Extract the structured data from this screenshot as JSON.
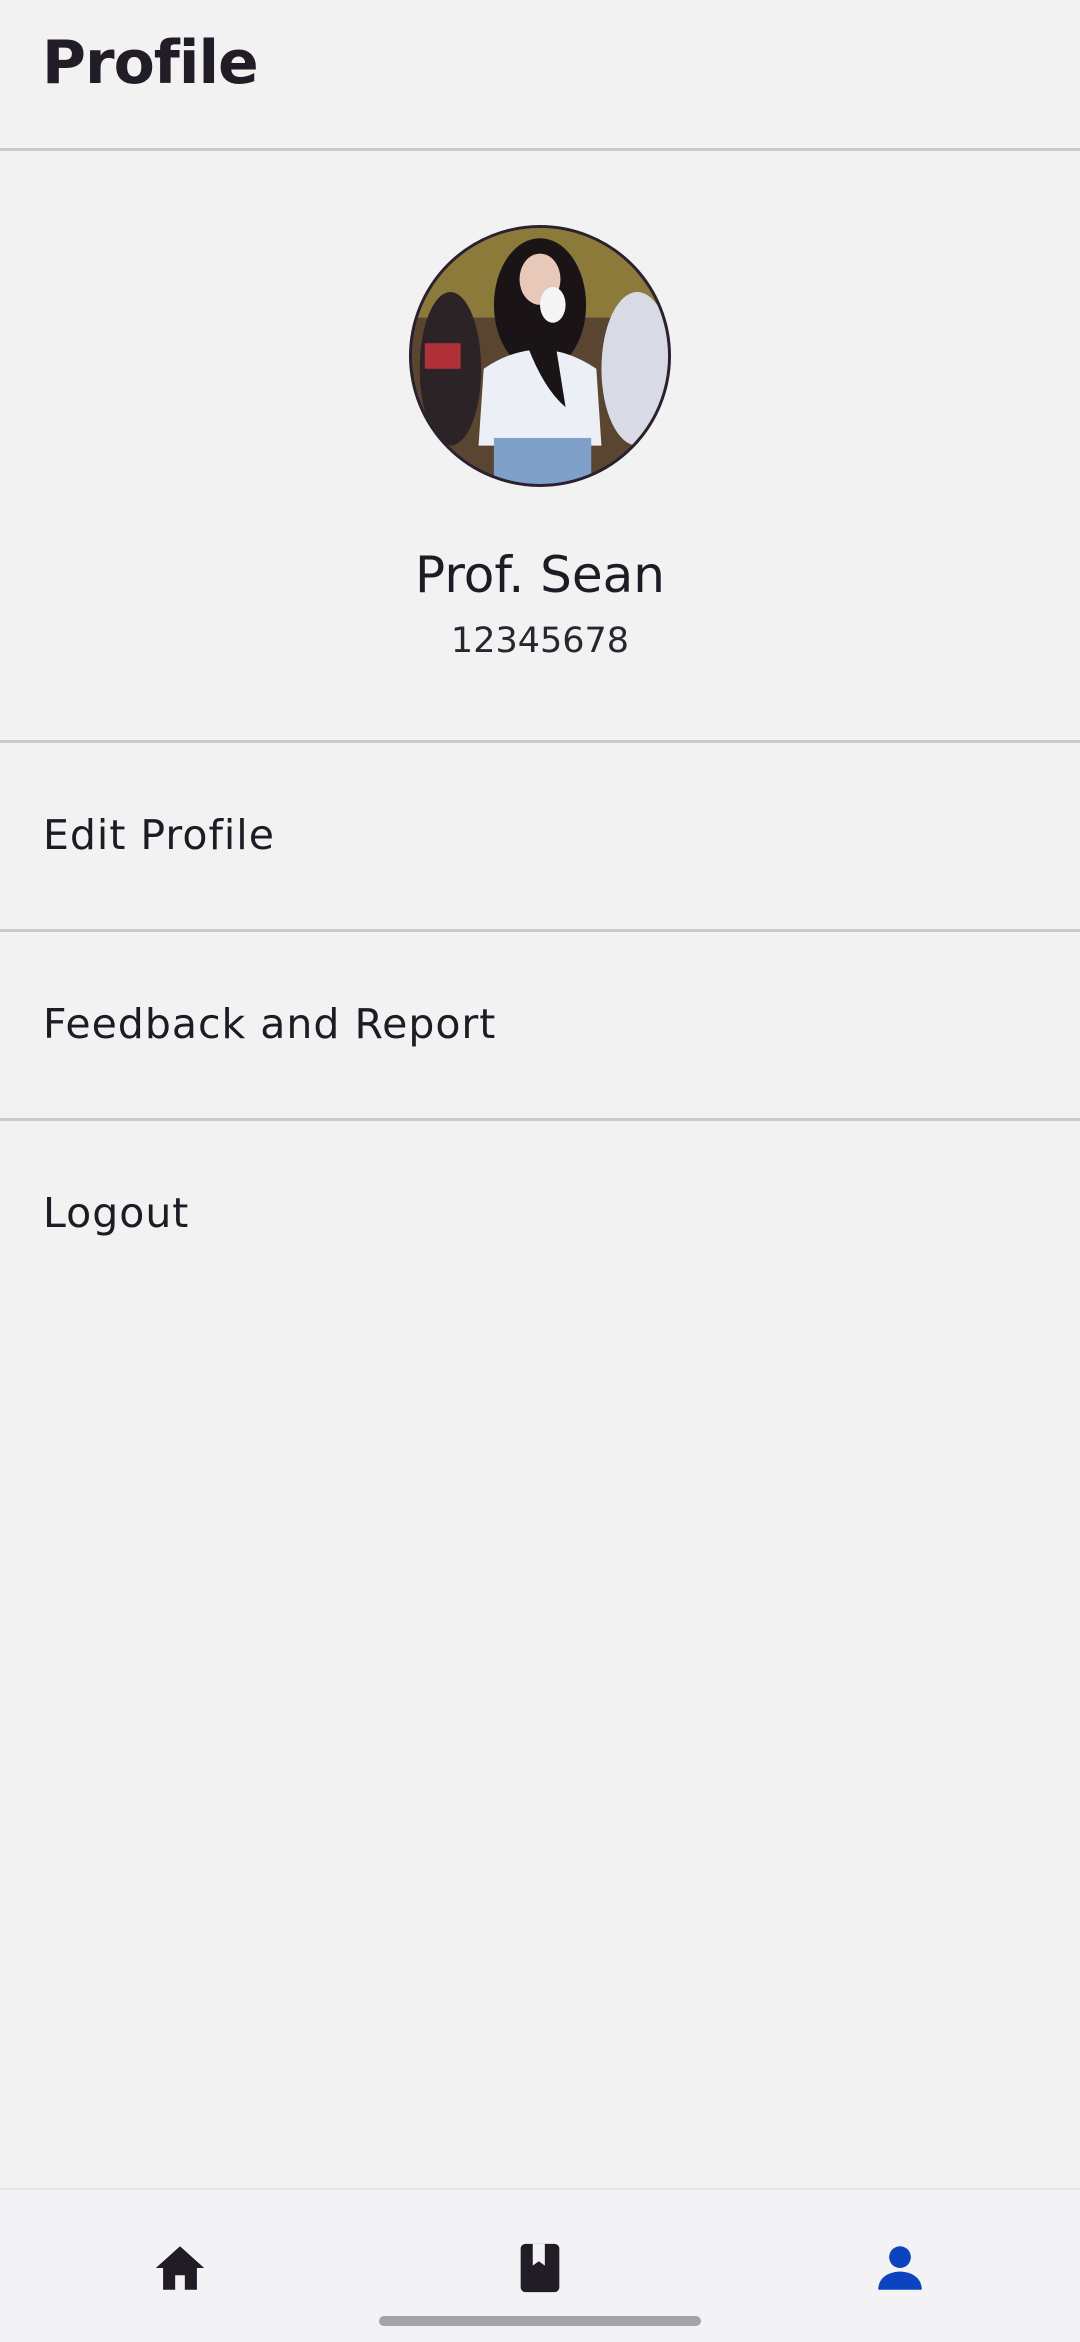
{
  "header": {
    "title": "Profile"
  },
  "profile": {
    "name": "Prof. Sean",
    "id": "12345678",
    "avatar_alt": "avatar"
  },
  "menu": {
    "items": [
      {
        "label": "Edit Profile"
      },
      {
        "label": "Feedback and Report"
      },
      {
        "label": "Logout"
      }
    ]
  },
  "bottom_nav": {
    "items": [
      {
        "icon": "home-icon",
        "active": false
      },
      {
        "icon": "book-icon",
        "active": false
      },
      {
        "icon": "person-icon",
        "active": true
      }
    ],
    "active_color": "#0b44be",
    "inactive_color": "#211c26"
  }
}
